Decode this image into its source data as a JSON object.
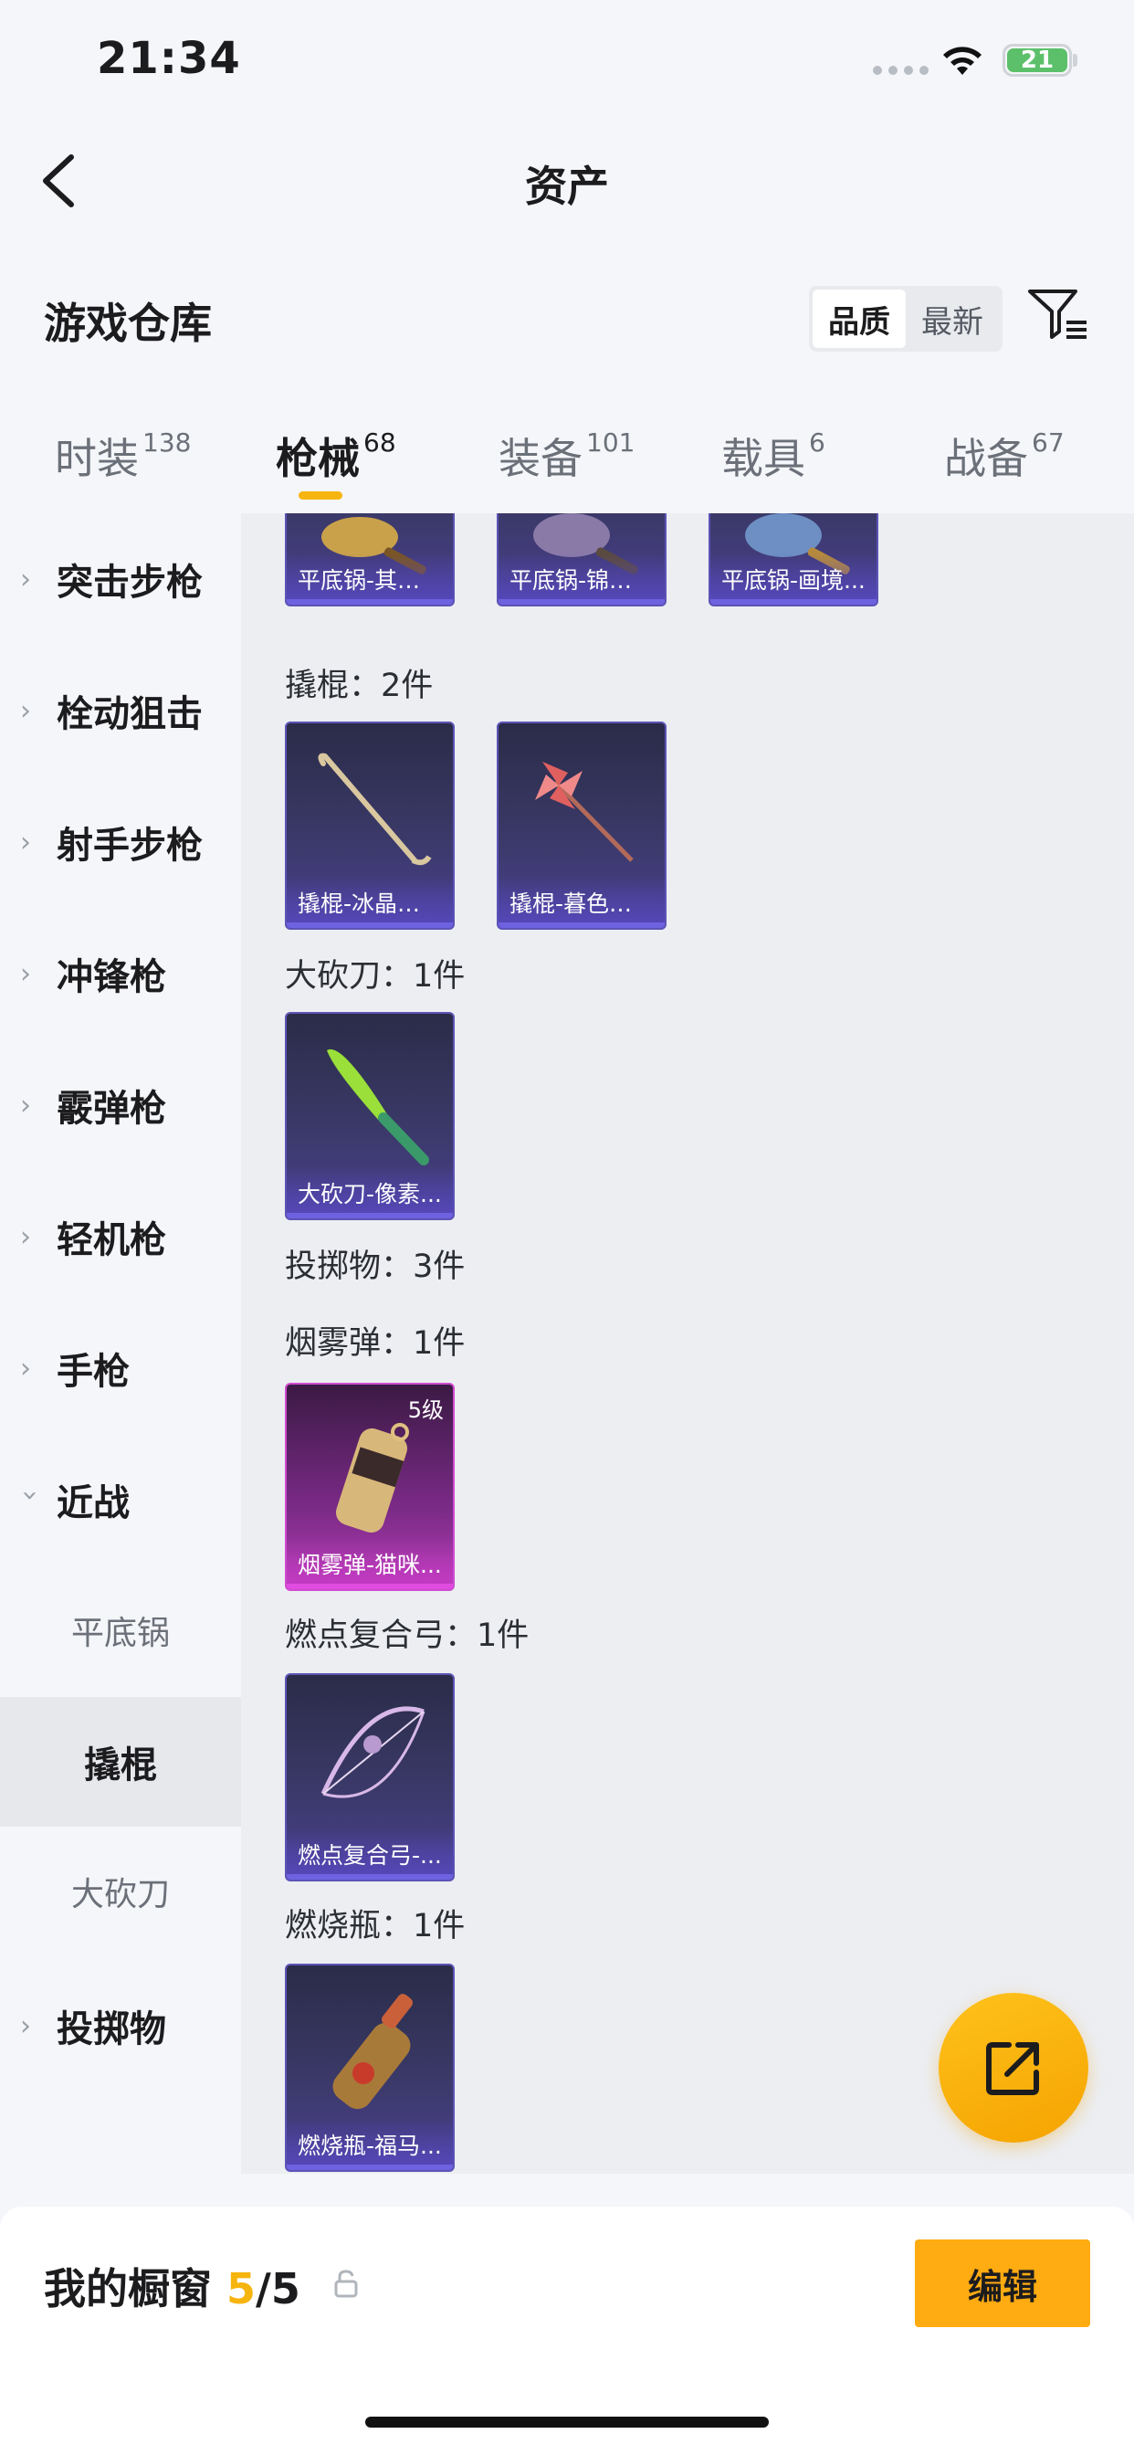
{
  "status_bar": {
    "time": "21:34",
    "battery": "21"
  },
  "header": {
    "title": "资产"
  },
  "warehouse": {
    "title": "游戏仓库",
    "sort_options": [
      "品质",
      "最新"
    ],
    "sort_selected": "品质"
  },
  "tabs": [
    {
      "label": "时装",
      "count": "138"
    },
    {
      "label": "枪械",
      "count": "68"
    },
    {
      "label": "装备",
      "count": "101"
    },
    {
      "label": "载具",
      "count": "6"
    },
    {
      "label": "战备",
      "count": "67"
    }
  ],
  "active_tab": "枪械",
  "sidebar": {
    "items": [
      {
        "label": "突击步枪"
      },
      {
        "label": "栓动狙击"
      },
      {
        "label": "射手步枪"
      },
      {
        "label": "冲锋枪"
      },
      {
        "label": "霰弹枪"
      },
      {
        "label": "轻机枪"
      },
      {
        "label": "手枪"
      },
      {
        "label": "近战",
        "expanded": true
      }
    ],
    "subitems": [
      {
        "label": "平底锅"
      },
      {
        "label": "撬棍",
        "selected": true
      },
      {
        "label": "大砍刀"
      }
    ],
    "after": [
      {
        "label": "投掷物"
      }
    ]
  },
  "content": {
    "pan_cards": [
      "平底锅-其乐融融",
      "平底锅-锦灰堆",
      "平底锅-画境..."
    ],
    "crowbar_header": "撬棍：2件",
    "crowbar_cards": [
      "撬棍-冰晶雪宝",
      "撬棍-暮色玫影"
    ],
    "machete_header": "大砍刀：1件",
    "machete_cards": [
      "大砍刀-像素..."
    ],
    "throwables_header": "投掷物：3件",
    "smoke_header": "烟雾弹：1件",
    "smoke_cards": [
      {
        "name": "烟雾弹-猫咪...",
        "level": "5级"
      }
    ],
    "bow_header": "燃点复合弓：1件",
    "bow_cards": [
      "燃点复合弓-..."
    ],
    "molotov_header": "燃烧瓶：1件",
    "molotov_cards": [
      "燃烧瓶-福马..."
    ]
  },
  "showcase": {
    "label": "我的橱窗",
    "used": "5",
    "total": "/5",
    "edit_label": "编辑"
  }
}
